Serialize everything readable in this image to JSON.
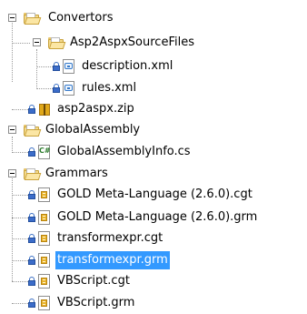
{
  "tree": {
    "nodes": [
      {
        "key": "convertors",
        "label": "Convertors",
        "kind": "folder",
        "expanded": true
      },
      {
        "key": "asp2aspx_source_files",
        "label": "Asp2AspxSourceFiles",
        "kind": "folder",
        "expanded": true
      },
      {
        "key": "description_xml",
        "label": "description.xml",
        "kind": "xml"
      },
      {
        "key": "rules_xml",
        "label": "rules.xml",
        "kind": "xml"
      },
      {
        "key": "asp2aspx_zip",
        "label": "asp2aspx.zip",
        "kind": "zip"
      },
      {
        "key": "global_assembly",
        "label": "GlobalAssembly",
        "kind": "folder",
        "expanded": true
      },
      {
        "key": "global_assembly_info",
        "label": "GlobalAssemblyInfo.cs",
        "kind": "csharp"
      },
      {
        "key": "grammars",
        "label": "Grammars",
        "kind": "folder",
        "expanded": true
      },
      {
        "key": "gold_cgt",
        "label": "GOLD Meta-Language (2.6.0).cgt",
        "kind": "grammar"
      },
      {
        "key": "gold_grm",
        "label": "GOLD Meta-Language (2.6.0).grm",
        "kind": "grammar"
      },
      {
        "key": "transformexpr_cgt",
        "label": "transformexpr.cgt",
        "kind": "grammar"
      },
      {
        "key": "transformexpr_grm",
        "label": "transformexpr.grm",
        "kind": "grammar",
        "selected": true
      },
      {
        "key": "vbscript_cgt",
        "label": "VBScript.cgt",
        "kind": "grammar"
      },
      {
        "key": "vbscript_grm",
        "label": "VBScript.grm",
        "kind": "grammar"
      }
    ],
    "icons": {
      "folder": "folder-icon",
      "xml": "xml-file-icon",
      "zip": "zip-file-icon",
      "csharp": "csharp-file-icon",
      "grammar": "grammar-file-icon",
      "lock": "lock-icon",
      "expander": "collapse-icon"
    },
    "colors": {
      "selection": "#3399ff",
      "folder": "#f3d98a",
      "lock": "#3b6cc9"
    }
  }
}
